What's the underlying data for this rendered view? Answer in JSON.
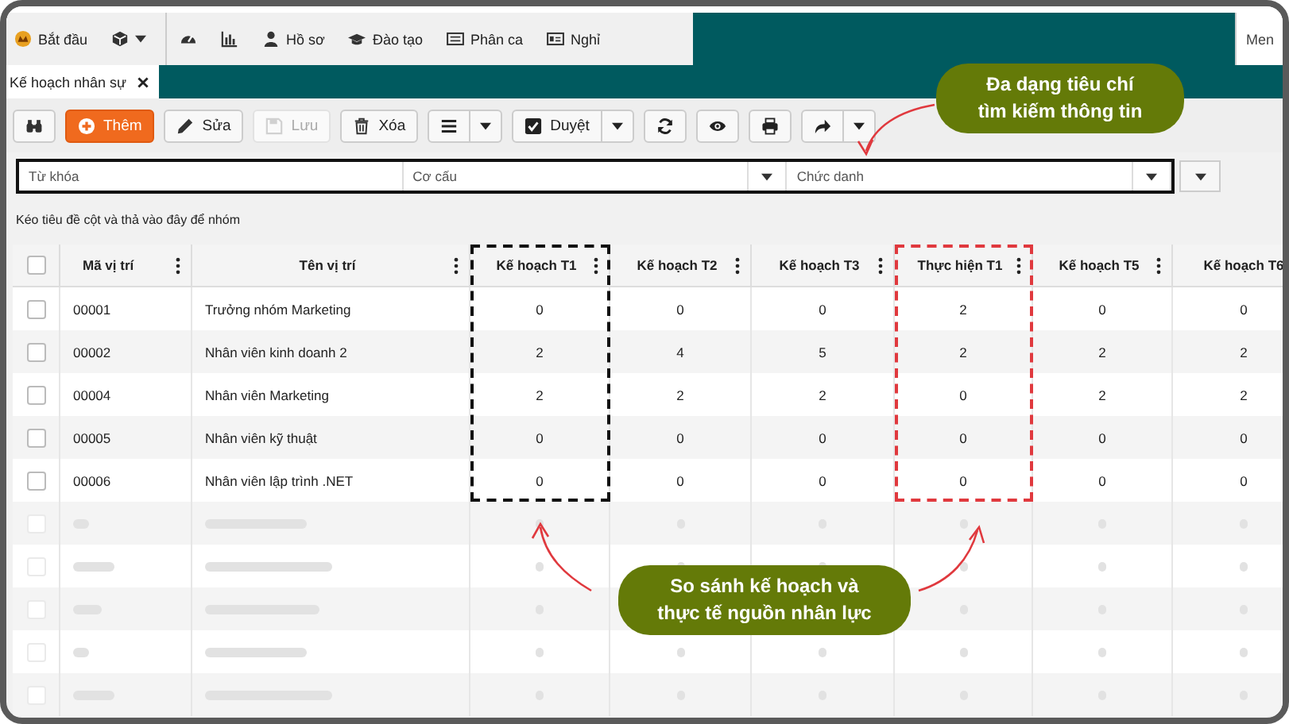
{
  "nav": {
    "items": [
      {
        "kind": "logo",
        "label": "Bắt đầu",
        "caret": false
      },
      {
        "kind": "cube",
        "caret": true
      },
      {
        "kind": "gauge",
        "caret": false
      },
      {
        "kind": "chart",
        "caret": false
      },
      {
        "kind": "person",
        "label": "Hồ sơ",
        "caret": false
      },
      {
        "kind": "cap",
        "label": "Đào tạo",
        "caret": false
      },
      {
        "kind": "list",
        "label": "Phân ca",
        "caret": false
      },
      {
        "kind": "card",
        "label": "Nghỉ",
        "caret": false
      }
    ],
    "menu_button": "Men"
  },
  "tabs": [
    {
      "label": "Kế hoạch nhân sự",
      "selected": true
    }
  ],
  "toolbar": [
    {
      "kind": "binoculars",
      "primary": false,
      "split": false,
      "disabled": false
    },
    {
      "kind": "plus",
      "label": "Thêm",
      "primary": true,
      "split": false,
      "disabled": false
    },
    {
      "kind": "pencil",
      "label": "Sửa",
      "primary": false,
      "split": false,
      "disabled": false
    },
    {
      "kind": "save",
      "label": "Lưu",
      "primary": false,
      "split": false,
      "disabled": true
    },
    {
      "kind": "trash",
      "label": "Xóa",
      "primary": false,
      "split": false,
      "disabled": false
    },
    {
      "kind": "bars",
      "primary": false,
      "split": true,
      "disabled": false
    },
    {
      "kind": "check",
      "label": "Duyệt",
      "primary": false,
      "split": true,
      "disabled": false
    },
    {
      "kind": "refresh",
      "primary": false,
      "split": false,
      "disabled": false
    },
    {
      "kind": "eye",
      "primary": false,
      "split": false,
      "disabled": false
    },
    {
      "kind": "print",
      "primary": false,
      "split": false,
      "disabled": false
    },
    {
      "kind": "share",
      "primary": false,
      "split": true,
      "disabled": false
    }
  ],
  "filters": [
    {
      "placeholder": "Từ khóa",
      "dropdown": false
    },
    {
      "placeholder": "Cơ cấu",
      "dropdown": true
    },
    {
      "placeholder": "Chức danh",
      "dropdown": true
    }
  ],
  "group_hint": "Kéo tiêu đề cột và thả vào đây để nhóm",
  "table": {
    "select_all": {
      "checked": false
    },
    "columns": [
      {
        "label": "Mã vị trí",
        "menu": true,
        "outlined": false
      },
      {
        "label": "Tên vị trí",
        "menu": true,
        "outlined": false
      },
      {
        "label": "Kế hoạch T1",
        "menu": true,
        "outlined": true,
        "color": "#111111"
      },
      {
        "label": "Kế hoạch T2",
        "menu": true,
        "outlined": false
      },
      {
        "label": "Kế hoạch T3",
        "menu": true,
        "outlined": false
      },
      {
        "label": "Thực hiện T1",
        "menu": true,
        "outlined": true,
        "color": "#e0393e"
      },
      {
        "label": "Kế hoạch T5",
        "menu": true,
        "outlined": false
      },
      {
        "label": "Kế hoạch T6",
        "menu": false,
        "outlined": false
      }
    ],
    "rows": [
      {
        "code": "00001",
        "name": "Trưởng nhóm Marketing",
        "values": [
          "0",
          "0",
          "0",
          "2",
          "0",
          "0"
        ],
        "checked": false,
        "blurred": false
      },
      {
        "code": "00002",
        "name": "Nhân viên kinh doanh 2",
        "values": [
          "2",
          "4",
          "5",
          "2",
          "2",
          "2"
        ],
        "checked": false,
        "blurred": false
      },
      {
        "code": "00004",
        "name": "Nhân viên Marketing",
        "values": [
          "2",
          "2",
          "2",
          "0",
          "2",
          "2"
        ],
        "checked": false,
        "blurred": false
      },
      {
        "code": "00005",
        "name": "Nhân viên kỹ thuật",
        "values": [
          "0",
          "0",
          "0",
          "0",
          "0",
          "0"
        ],
        "checked": false,
        "blurred": false
      },
      {
        "code": "00006",
        "name": "Nhân viên lập trình .NET",
        "values": [
          "0",
          "0",
          "0",
          "0",
          "0",
          "0"
        ],
        "checked": false,
        "blurred": false
      },
      {
        "checked": false,
        "blurred": true
      },
      {
        "checked": false,
        "blurred": true
      },
      {
        "checked": false,
        "blurred": true
      },
      {
        "checked": false,
        "blurred": true
      },
      {
        "checked": false,
        "blurred": true
      }
    ]
  },
  "callouts": [
    {
      "lines": [
        "Đa dạng tiêu chí",
        "tìm kiếm thông tin"
      ]
    },
    {
      "lines": [
        "So sánh kế hoạch và",
        "thực tế nguồn nhân lực"
      ]
    }
  ]
}
